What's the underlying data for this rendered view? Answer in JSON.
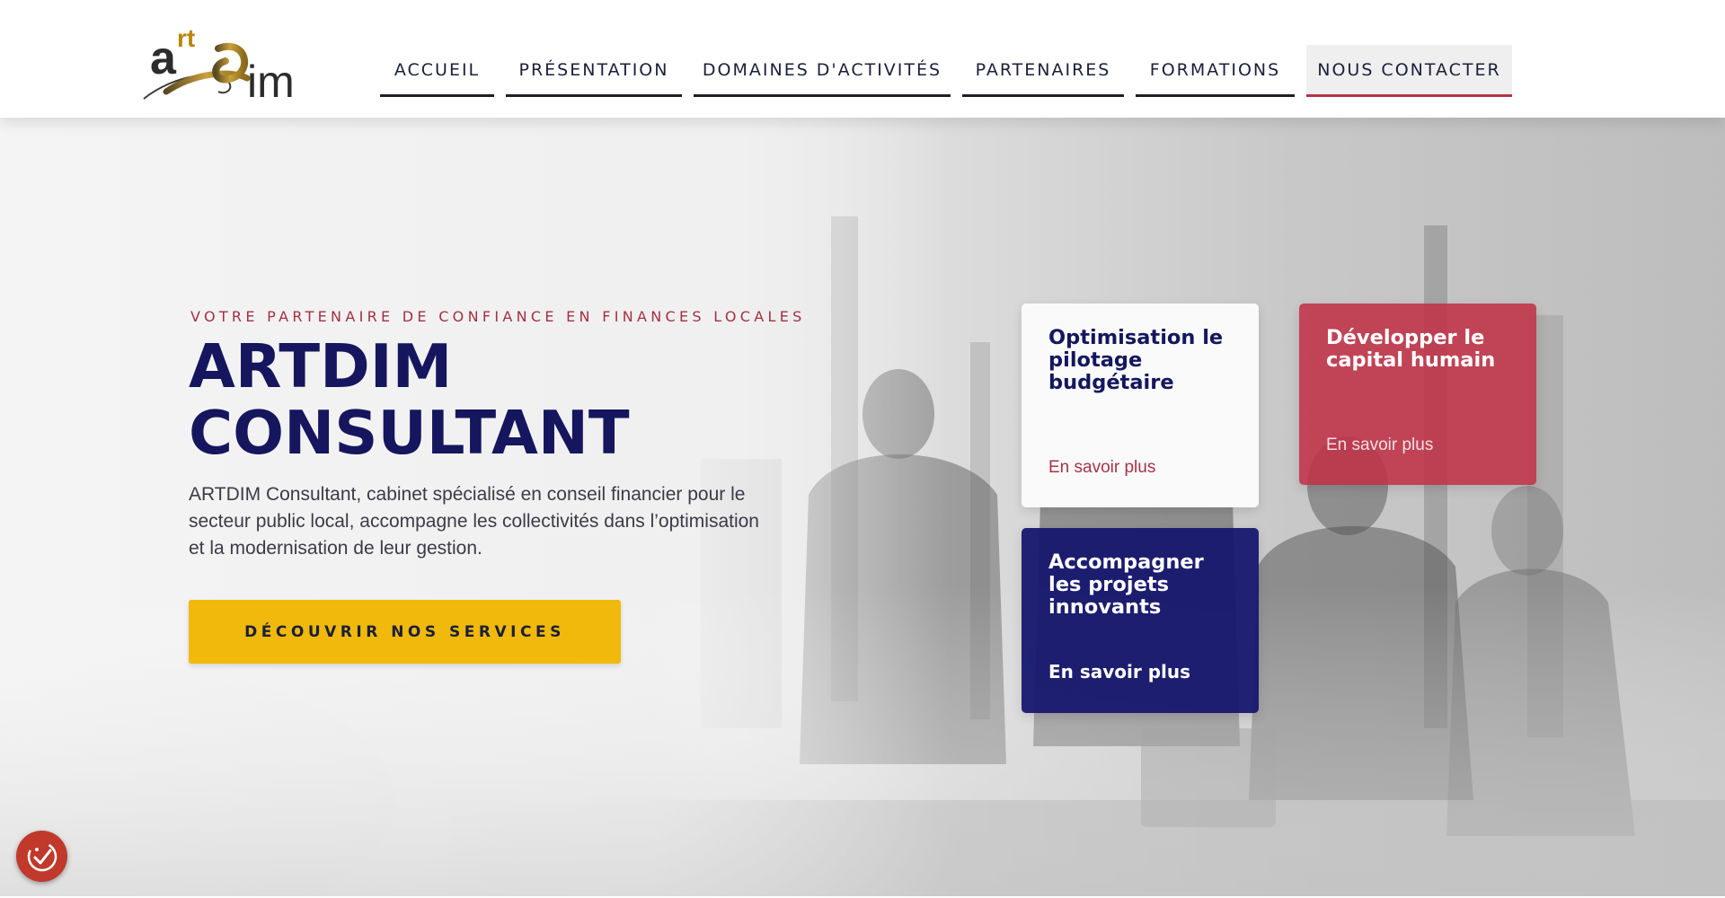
{
  "brand": {
    "logo_text_top": "art",
    "logo_text_bottom": "dim",
    "logo_alt": "artdim logo",
    "colors": {
      "gold": "#b8860b",
      "navy": "#15165e",
      "red": "#b43347",
      "yellow": "#f0b90b"
    }
  },
  "nav": {
    "items": [
      {
        "label": "ACCUEIL"
      },
      {
        "label": "PRÉSENTATION"
      },
      {
        "label": "DOMAINES D'ACTIVITÉS"
      },
      {
        "label": "PARTENAIRES"
      },
      {
        "label": "FORMATIONS"
      },
      {
        "label": "NOUS CONTACTER"
      }
    ],
    "active": "NOUS CONTACTER"
  },
  "hero": {
    "tagline": "VOTRE PARTENAIRE DE CONFIANCE EN FINANCES LOCALES",
    "title_line1": "ARTDIM",
    "title_line2": "CONSULTANT",
    "description": "ARTDIM Consultant, cabinet spécialisé en conseil financier pour le secteur public local, accompagne les collectivités dans l’optimisation et la modernisation de leur gestion.",
    "cta_label": "DÉCOUVRIR NOS SERVICES"
  },
  "cards": [
    {
      "title": "Optimisation le pilotage budgétaire",
      "link": "En savoir plus",
      "style": "white"
    },
    {
      "title": "Développer le capital humain",
      "link": "En savoir plus",
      "style": "red"
    },
    {
      "title": "Accompagner les projets innovants",
      "link": "En savoir plus",
      "style": "navy"
    }
  ],
  "accessibility": {
    "icon": "accessibility-check-icon",
    "color": "#c0392b"
  }
}
